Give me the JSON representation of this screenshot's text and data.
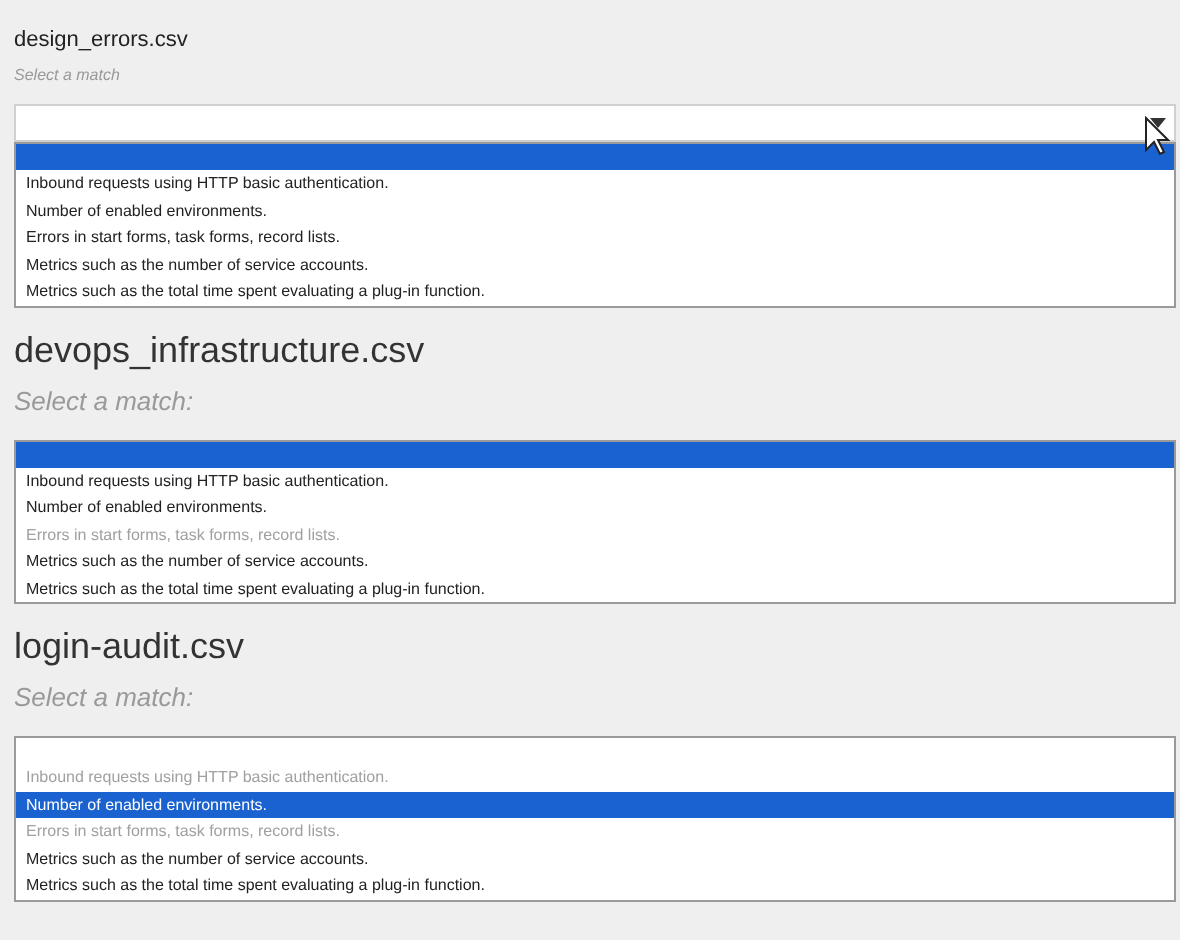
{
  "sections": [
    {
      "title": "design_errors.csv",
      "kind": "dropdown",
      "prompt": "Select a match",
      "blank_option": {
        "selected": true
      },
      "options": [
        {
          "text": "Inbound requests using HTTP basic authentication.",
          "selected": false,
          "disabled": false
        },
        {
          "text": "Number of enabled environments.",
          "selected": false,
          "disabled": false
        },
        {
          "text": "Errors in start forms, task forms, record lists.",
          "selected": false,
          "disabled": false
        },
        {
          "text": "Metrics such as the number of service accounts.",
          "selected": false,
          "disabled": false
        },
        {
          "text": "Metrics such as the total time spent evaluating a plug-in function.",
          "selected": false,
          "disabled": false
        }
      ]
    },
    {
      "title": "devops_infrastructure.csv",
      "kind": "list",
      "prompt": "Select a match:",
      "blank_option": {
        "selected": true
      },
      "options": [
        {
          "text": "Inbound requests using HTTP basic authentication.",
          "selected": false,
          "disabled": false
        },
        {
          "text": "Number of enabled environments.",
          "selected": false,
          "disabled": false
        },
        {
          "text": "Errors in start forms, task forms, record lists.",
          "selected": false,
          "disabled": true
        },
        {
          "text": "Metrics such as the number of service accounts.",
          "selected": false,
          "disabled": false
        },
        {
          "text": "Metrics such as the total time spent evaluating a plug-in function.",
          "selected": false,
          "disabled": false
        }
      ]
    },
    {
      "title": "login-audit.csv",
      "kind": "list",
      "prompt": "Select a match:",
      "blank_option": {
        "selected": false
      },
      "options": [
        {
          "text": "Inbound requests using HTTP basic authentication.",
          "selected": false,
          "disabled": true
        },
        {
          "text": "Number of enabled environments.",
          "selected": true,
          "disabled": false
        },
        {
          "text": "Errors in start forms, task forms, record lists.",
          "selected": false,
          "disabled": true
        },
        {
          "text": "Metrics such as the number of service accounts.",
          "selected": false,
          "disabled": false
        },
        {
          "text": "Metrics such as the total time spent evaluating a plug-in function.",
          "selected": false,
          "disabled": false
        }
      ]
    }
  ]
}
